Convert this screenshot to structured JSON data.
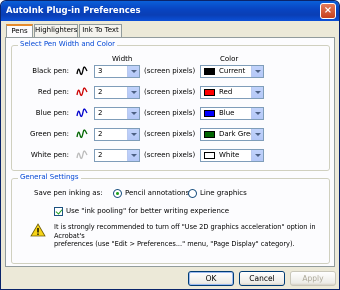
{
  "window": {
    "title": "AutoInk Plug-in Preferences",
    "close": "×"
  },
  "tabs": [
    {
      "label": "Pens",
      "active": true
    },
    {
      "label": "Highlighters",
      "active": false
    },
    {
      "label": "Ink To Text",
      "active": false
    }
  ],
  "pen_section": {
    "title": "Select Pen Width and Color",
    "width_header": "Width",
    "color_header": "Color",
    "unit_label": "(screen pixels)",
    "rows": [
      {
        "label": "Black pen:",
        "icon_color": "#000000",
        "width": "3",
        "color_name": "Current",
        "swatch": "#000000"
      },
      {
        "label": "Red pen:",
        "icon_color": "#cc0000",
        "width": "2",
        "color_name": "Red",
        "swatch": "#ff0000"
      },
      {
        "label": "Blue pen:",
        "icon_color": "#0000cc",
        "width": "2",
        "color_name": "Blue",
        "swatch": "#0000ff"
      },
      {
        "label": "Green pen:",
        "icon_color": "#006600",
        "width": "2",
        "color_name": "Dark Green",
        "swatch": "#006400"
      },
      {
        "label": "White pen:",
        "icon_color": "#bbbbbb",
        "width": "2",
        "color_name": "White",
        "swatch": "#ffffff"
      }
    ]
  },
  "general": {
    "title": "General Settings",
    "save_label": "Save pen inking as:",
    "option_pencil": "Pencil annotations",
    "option_line": "Line graphics",
    "selected": "pencil",
    "ink_pooling_label": "Use \"ink pooling\" for better writing experience",
    "ink_pooling_checked": true,
    "note_line1": "It is strongly recommended to turn off \"Use 2D graphics acceleration\" option in Acrobat's",
    "note_line2": "preferences (use \"Edit > Preferences...\" menu, \"Page Display\" category)."
  },
  "buttons": {
    "ok": "OK",
    "cancel": "Cancel",
    "apply": "Apply"
  },
  "colors": {
    "title_bar": "#0845c2",
    "group_title": "#0046d5",
    "panel_bg": "#fcfcfe",
    "window_bg": "#ece9d8"
  }
}
